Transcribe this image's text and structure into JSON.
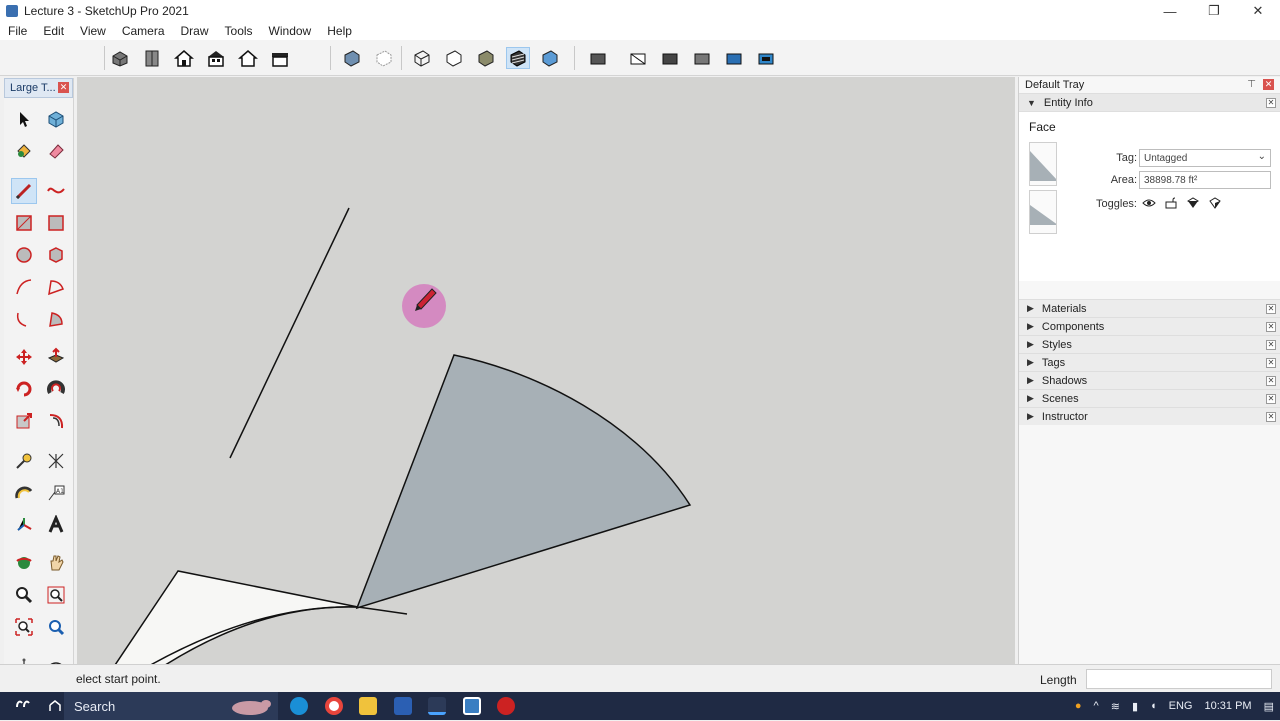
{
  "window": {
    "title": "Lecture 3 - SketchUp Pro 2021",
    "minimize": "—",
    "restore": "❐",
    "close": "✕"
  },
  "menu": [
    "File",
    "Edit",
    "View",
    "Camera",
    "Draw",
    "Tools",
    "Window",
    "Help"
  ],
  "left_panel": {
    "title": "Large T..."
  },
  "tray": {
    "title": "Default Tray",
    "entity_info": {
      "heading": "Entity Info",
      "type": "Face",
      "tag_label": "Tag:",
      "tag_value": "Untagged",
      "area_label": "Area:",
      "area_value": "38898.78 ft²",
      "toggles_label": "Toggles:"
    },
    "sections": [
      "Materials",
      "Components",
      "Styles",
      "Tags",
      "Shadows",
      "Scenes",
      "Instructor"
    ]
  },
  "status": {
    "message": "elect start point.",
    "vcb_label": "Length",
    "vcb_value": ""
  },
  "taskbar": {
    "search": "Search",
    "lang": "ENG",
    "time": "10:31 PM"
  },
  "icons": [
    "select-icon",
    "make-component-icon",
    "paint-bucket-icon",
    "eraser-icon",
    "line-icon",
    "freehand-icon",
    "rectangle-icon",
    "rotated-rectangle-icon",
    "circle-icon",
    "polygon-icon",
    "arc-icon",
    "pie-icon",
    "move-icon",
    "push-pull-icon",
    "rotate-icon",
    "follow-me-icon",
    "scale-icon",
    "offset-icon",
    "tape-measure-icon",
    "dimension-icon",
    "protractor-icon",
    "text-icon",
    "axes-icon",
    "3d-text-icon",
    "orbit-icon",
    "pan-icon",
    "zoom-icon",
    "zoom-window-icon",
    "zoom-extents-icon",
    "previous-icon",
    "walk-icon",
    "look-around-icon",
    "section-plane-icon"
  ],
  "colors": {
    "viewport": "#d3d3d1",
    "face": "#a7b0b6",
    "face_back": "#f7f7f5",
    "cursor_highlight": "#d64fb4",
    "taskbar": "#1f2a44"
  }
}
